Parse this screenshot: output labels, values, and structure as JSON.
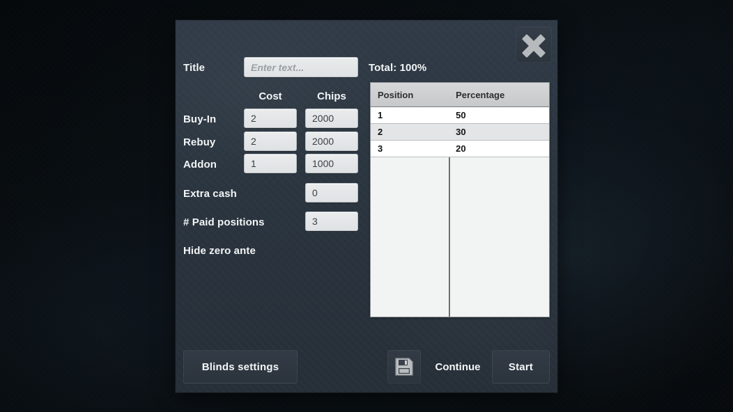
{
  "dialog": {
    "close_icon": "close-x-icon",
    "title_label": "Title",
    "title_input_placeholder": "Enter text...",
    "title_input_value": "",
    "total_label": "Total: 100%",
    "column_headers": {
      "cost": "Cost",
      "chips": "Chips"
    },
    "rows": [
      {
        "label": "Buy-In",
        "cost": "2",
        "chips": "2000"
      },
      {
        "label": "Rebuy",
        "cost": "2",
        "chips": "2000"
      },
      {
        "label": "Addon",
        "cost": "1",
        "chips": "1000"
      }
    ],
    "extra_cash": {
      "label": "Extra cash",
      "value": "0"
    },
    "paid_positions": {
      "label": "# Paid positions",
      "value": "3"
    },
    "hide_zero_ante": {
      "label": "Hide zero ante",
      "checked": false
    }
  },
  "payout_table": {
    "headers": [
      "Position",
      "Percentage"
    ],
    "rows": [
      [
        "1",
        "50"
      ],
      [
        "2",
        "30"
      ],
      [
        "3",
        "20"
      ]
    ]
  },
  "footer": {
    "blinds_settings_label": "Blinds settings",
    "save_icon": "floppy-disk-save-icon",
    "continue_label": "Continue",
    "start_label": "Start"
  },
  "colors": {
    "panel_bg": "#2c3742",
    "page_bg": "#0b1117",
    "input_bg": "#e3e5e6",
    "table_header_bg": "#cdcfd0",
    "text_light": "#f3f5f6"
  }
}
